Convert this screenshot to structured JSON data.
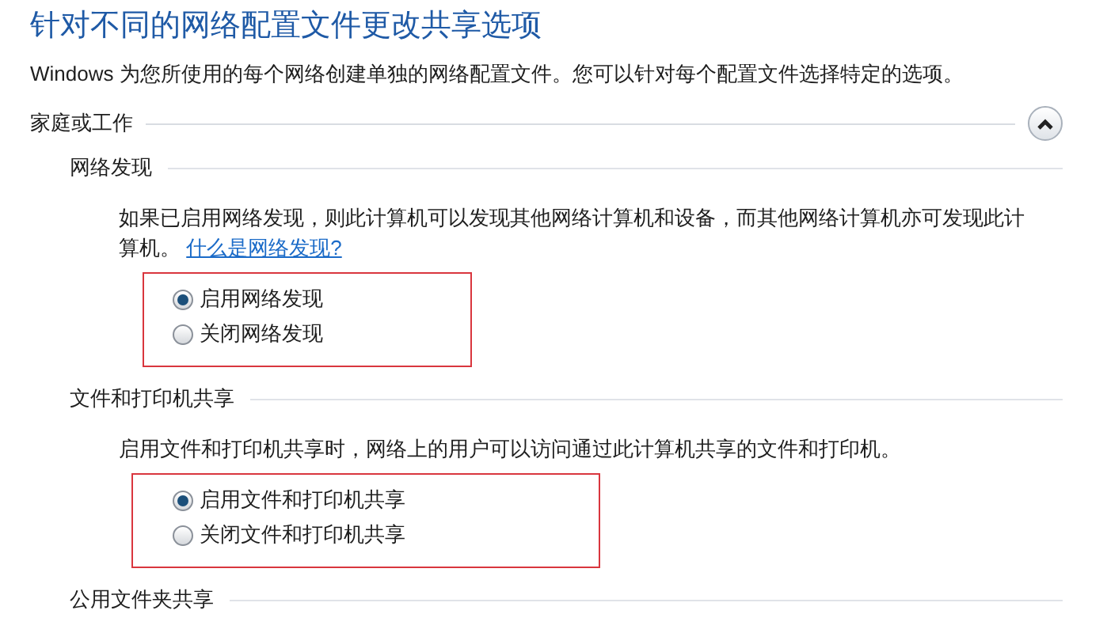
{
  "title": "针对不同的网络配置文件更改共享选项",
  "description": "Windows 为您所使用的每个网络创建单独的网络配置文件。您可以针对每个配置文件选择特定的选项。",
  "profile": {
    "label": "家庭或工作",
    "expanded": true
  },
  "sections": [
    {
      "heading": "网络发现",
      "text": "如果已启用网络发现，则此计算机可以发现其他网络计算机和设备，而其他网络计算机亦可发现此计算机。",
      "link": "什么是网络发现?",
      "highlighted": true,
      "options": [
        {
          "label": "启用网络发现",
          "selected": true
        },
        {
          "label": "关闭网络发现",
          "selected": false
        }
      ]
    },
    {
      "heading": "文件和打印机共享",
      "text": "启用文件和打印机共享时，网络上的用户可以访问通过此计算机共享的文件和打印机。",
      "highlighted": true,
      "options": [
        {
          "label": "启用文件和打印机共享",
          "selected": true
        },
        {
          "label": "关闭文件和打印机共享",
          "selected": false
        }
      ]
    },
    {
      "heading": "公用文件夹共享"
    }
  ]
}
